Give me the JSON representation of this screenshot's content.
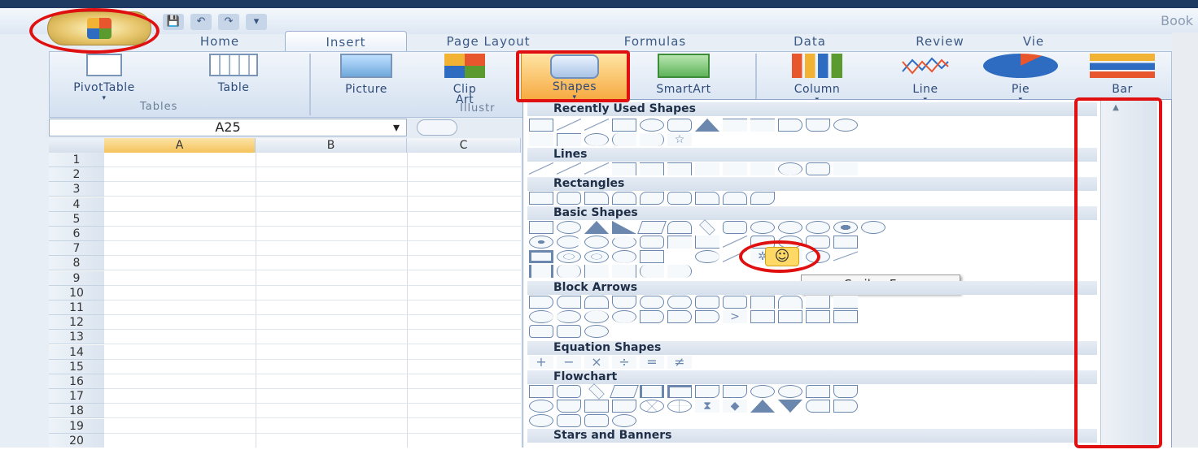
{
  "title": "Book",
  "qat": {
    "save_label": "💾",
    "undo_label": "↶",
    "redo_label": "↷",
    "more_label": "▾"
  },
  "tabs": [
    "Home",
    "Insert",
    "Page Layout",
    "Formulas",
    "Data",
    "Review",
    "Vie"
  ],
  "active_tab": "Insert",
  "ribbon": {
    "buttons": [
      {
        "label": "PivotTable",
        "sublabel": "▾"
      },
      {
        "label": "Table",
        "sublabel": ""
      },
      {
        "label": "Picture",
        "sublabel": ""
      },
      {
        "label": "Clip",
        "sublabel": "Art"
      },
      {
        "label": "Shapes",
        "sublabel": "▾"
      },
      {
        "label": "SmartArt",
        "sublabel": ""
      },
      {
        "label": "Column",
        "sublabel": "▾"
      },
      {
        "label": "Line",
        "sublabel": "▾"
      },
      {
        "label": "Pie",
        "sublabel": "▾"
      },
      {
        "label": "Bar",
        "sublabel": "▾"
      }
    ],
    "groups": [
      "Tables",
      "Illustr"
    ]
  },
  "namebox": {
    "value": "A25",
    "dropdown": "▾"
  },
  "columns": [
    "A",
    "B",
    "C"
  ],
  "rows": [
    "1",
    "2",
    "3",
    "4",
    "5",
    "6",
    "7",
    "8",
    "9",
    "10",
    "11",
    "12",
    "13",
    "14",
    "15",
    "16",
    "17",
    "18",
    "19",
    "20"
  ],
  "gallery": {
    "sections": [
      "Recently Used Shapes",
      "Lines",
      "Rectangles",
      "Basic Shapes",
      "Block Arrows",
      "Equation Shapes",
      "Flowchart",
      "Stars and Banners"
    ],
    "tooltip": "Smiley Face",
    "smiley_glyph": "☺",
    "scroll_up": "▲"
  },
  "colors": {
    "highlight": "#e01010",
    "accent": "#f5a623"
  }
}
